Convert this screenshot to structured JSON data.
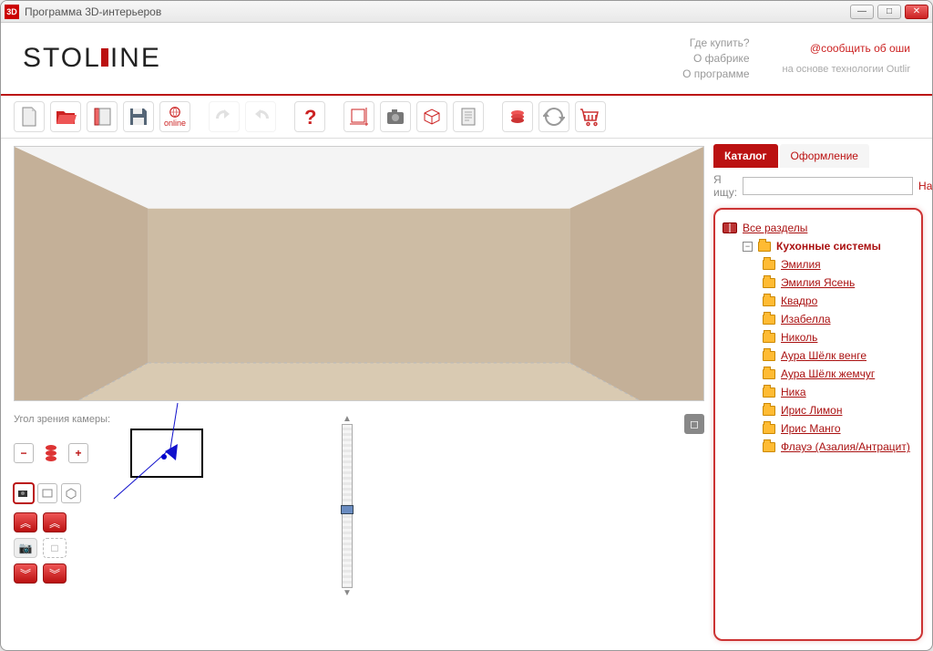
{
  "window": {
    "title": "Программа 3D-интерьеров",
    "app_icon_text": "3D"
  },
  "header": {
    "logo_text": "STOLLINE",
    "links": [
      "Где купить?",
      "О фабрике",
      "О программе"
    ],
    "report_link": "@сообщить об оши",
    "based_on": "на основе технологии Outlir"
  },
  "toolbar": {
    "online_label": "online"
  },
  "tabs": {
    "catalog": "Каталог",
    "design": "Оформление"
  },
  "search": {
    "label": "Я ищу:",
    "value": "",
    "find": "Найти"
  },
  "catalog": {
    "root": "Все разделы",
    "category": "Кухонные системы",
    "items": [
      "Эмилия",
      "Эмилия Ясень",
      "Квадро",
      "Изабелла",
      "Николь",
      "Аура Шёлк венге",
      "Аура Шёлк жемчуг",
      "Ника",
      "Ирис Лимон",
      "Ирис Манго",
      "Флауэ (Азалия/Антрацит)"
    ]
  },
  "camera": {
    "label": "Угол зрения камеры:"
  }
}
